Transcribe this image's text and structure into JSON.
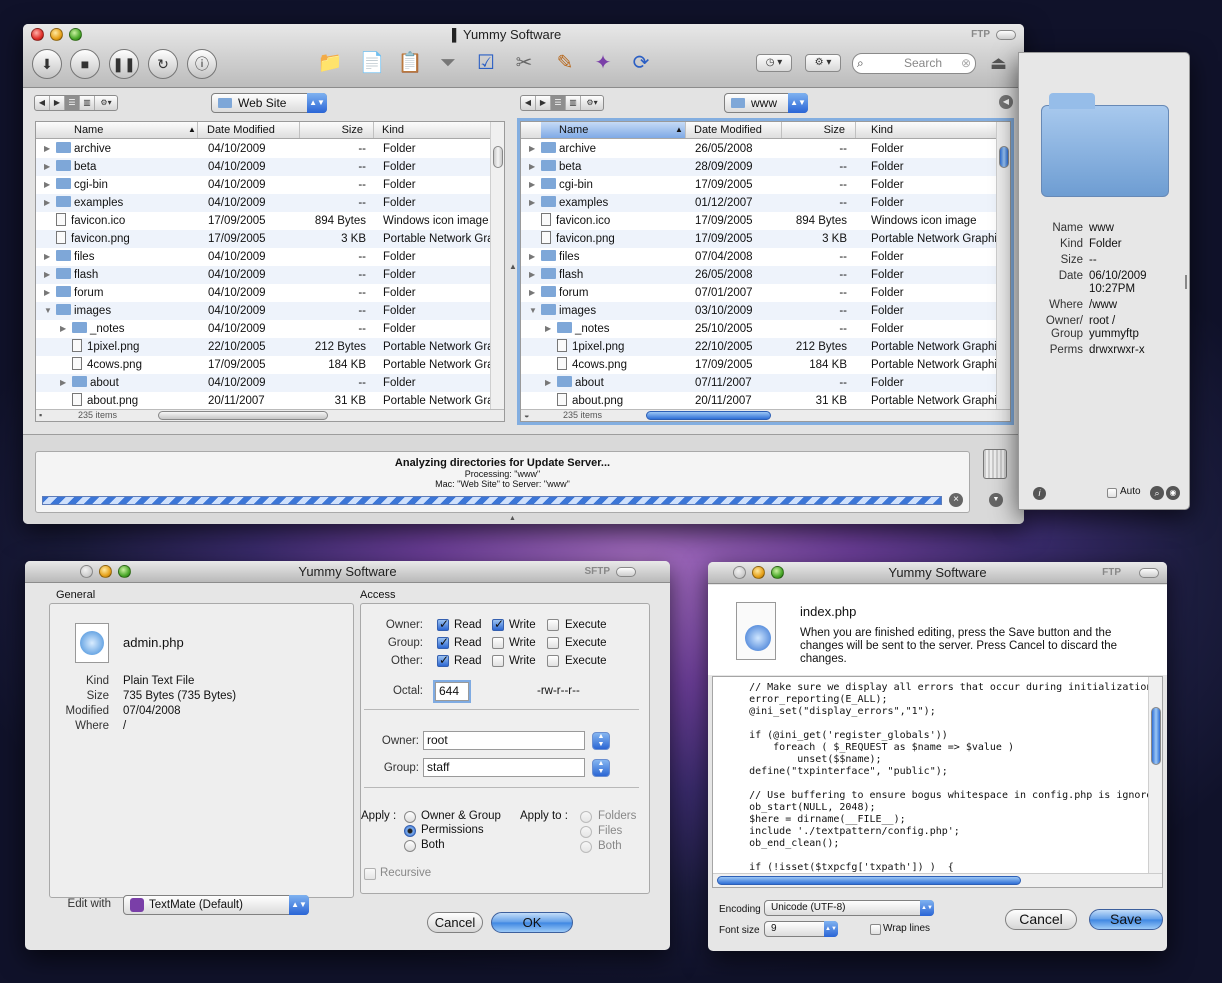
{
  "main_window": {
    "title": "Yummy Software",
    "protocol": "FTP",
    "search_placeholder": "Search",
    "left_path": "Web Site",
    "right_path": "www",
    "columns": {
      "name": "Name",
      "date": "Date Modified",
      "size": "Size",
      "kind": "Kind"
    },
    "left_rows": [
      {
        "name": "archive",
        "date": "04/10/2009",
        "size": "--",
        "kind": "Folder",
        "type": "folder",
        "level": 0,
        "tri": "▶"
      },
      {
        "name": "beta",
        "date": "04/10/2009",
        "size": "--",
        "kind": "Folder",
        "type": "folder",
        "level": 0,
        "tri": "▶"
      },
      {
        "name": "cgi-bin",
        "date": "04/10/2009",
        "size": "--",
        "kind": "Folder",
        "type": "folder",
        "level": 0,
        "tri": "▶"
      },
      {
        "name": "examples",
        "date": "04/10/2009",
        "size": "--",
        "kind": "Folder",
        "type": "folder",
        "level": 0,
        "tri": "▶"
      },
      {
        "name": "favicon.ico",
        "date": "17/09/2005",
        "size": "894 Bytes",
        "kind": "Windows icon image",
        "type": "doc",
        "level": 0,
        "tri": ""
      },
      {
        "name": "favicon.png",
        "date": "17/09/2005",
        "size": "3 KB",
        "kind": "Portable Network Graphics",
        "type": "doc",
        "level": 0,
        "tri": ""
      },
      {
        "name": "files",
        "date": "04/10/2009",
        "size": "--",
        "kind": "Folder",
        "type": "folder",
        "level": 0,
        "tri": "▶"
      },
      {
        "name": "flash",
        "date": "04/10/2009",
        "size": "--",
        "kind": "Folder",
        "type": "folder",
        "level": 0,
        "tri": "▶"
      },
      {
        "name": "forum",
        "date": "04/10/2009",
        "size": "--",
        "kind": "Folder",
        "type": "folder",
        "level": 0,
        "tri": "▶"
      },
      {
        "name": "images",
        "date": "04/10/2009",
        "size": "--",
        "kind": "Folder",
        "type": "folder",
        "level": 0,
        "tri": "▼"
      },
      {
        "name": "_notes",
        "date": "04/10/2009",
        "size": "--",
        "kind": "Folder",
        "type": "folder",
        "level": 1,
        "tri": "▶"
      },
      {
        "name": "1pixel.png",
        "date": "22/10/2005",
        "size": "212 Bytes",
        "kind": "Portable Network Graphics",
        "type": "doc",
        "level": 1,
        "tri": ""
      },
      {
        "name": "4cows.png",
        "date": "17/09/2005",
        "size": "184 KB",
        "kind": "Portable Network Graphics",
        "type": "doc",
        "level": 1,
        "tri": ""
      },
      {
        "name": "about",
        "date": "04/10/2009",
        "size": "--",
        "kind": "Folder",
        "type": "folder",
        "level": 1,
        "tri": "▶"
      },
      {
        "name": "about.png",
        "date": "20/11/2007",
        "size": "31 KB",
        "kind": "Portable Network Graphics",
        "type": "doc",
        "level": 1,
        "tri": ""
      }
    ],
    "right_rows": [
      {
        "name": "archive",
        "date": "26/05/2008",
        "size": "--",
        "kind": "Folder",
        "type": "folder",
        "level": 0,
        "tri": "▶"
      },
      {
        "name": "beta",
        "date": "28/09/2009",
        "size": "--",
        "kind": "Folder",
        "type": "folder",
        "level": 0,
        "tri": "▶"
      },
      {
        "name": "cgi-bin",
        "date": "17/09/2005",
        "size": "--",
        "kind": "Folder",
        "type": "folder",
        "level": 0,
        "tri": "▶"
      },
      {
        "name": "examples",
        "date": "01/12/2007",
        "size": "--",
        "kind": "Folder",
        "type": "folder",
        "level": 0,
        "tri": "▶"
      },
      {
        "name": "favicon.ico",
        "date": "17/09/2005",
        "size": "894 Bytes",
        "kind": "Windows icon image",
        "type": "doc",
        "level": 0,
        "tri": ""
      },
      {
        "name": "favicon.png",
        "date": "17/09/2005",
        "size": "3 KB",
        "kind": "Portable Network Graphics",
        "type": "doc",
        "level": 0,
        "tri": ""
      },
      {
        "name": "files",
        "date": "07/04/2008",
        "size": "--",
        "kind": "Folder",
        "type": "folder",
        "level": 0,
        "tri": "▶"
      },
      {
        "name": "flash",
        "date": "26/05/2008",
        "size": "--",
        "kind": "Folder",
        "type": "folder",
        "level": 0,
        "tri": "▶"
      },
      {
        "name": "forum",
        "date": "07/01/2007",
        "size": "--",
        "kind": "Folder",
        "type": "folder",
        "level": 0,
        "tri": "▶"
      },
      {
        "name": "images",
        "date": "03/10/2009",
        "size": "--",
        "kind": "Folder",
        "type": "folder",
        "level": 0,
        "tri": "▼"
      },
      {
        "name": "_notes",
        "date": "25/10/2005",
        "size": "--",
        "kind": "Folder",
        "type": "folder",
        "level": 1,
        "tri": "▶"
      },
      {
        "name": "1pixel.png",
        "date": "22/10/2005",
        "size": "212 Bytes",
        "kind": "Portable Network Graphics",
        "type": "doc",
        "level": 1,
        "tri": ""
      },
      {
        "name": "4cows.png",
        "date": "17/09/2005",
        "size": "184 KB",
        "kind": "Portable Network Graphics",
        "type": "doc",
        "level": 1,
        "tri": ""
      },
      {
        "name": "about",
        "date": "07/11/2007",
        "size": "--",
        "kind": "Folder",
        "type": "folder",
        "level": 1,
        "tri": "▶"
      },
      {
        "name": "about.png",
        "date": "20/11/2007",
        "size": "31 KB",
        "kind": "Portable Network Graphics",
        "type": "doc",
        "level": 1,
        "tri": ""
      }
    ],
    "left_count": "235 items",
    "right_count": "235 items",
    "status_title": "Analyzing directories for Update Server...",
    "status_processing": "Processing: \"www\"",
    "status_detail": "Mac: \"Web Site\" to Server: \"www\"",
    "progress": 1.0
  },
  "info_panel": {
    "name_label": "Name",
    "name": "www",
    "kind_label": "Kind",
    "kind": "Folder",
    "size_label": "Size",
    "size": "--",
    "date_label": "Date",
    "date": "06/10/2009",
    "time": "10:27PM",
    "where_label": "Where",
    "where": "/www",
    "owner_label": "Owner/",
    "group_label": "Group",
    "owner": "root /",
    "group": "yummyftp",
    "perms_label": "Perms",
    "perms": "drwxrwxr-x",
    "auto_label": "Auto"
  },
  "perm_window": {
    "title": "Yummy Software",
    "protocol": "SFTP",
    "general": "General",
    "access": "Access",
    "filename": "admin.php",
    "kind_label": "Kind",
    "kind": "Plain Text File",
    "size_label": "Size",
    "size": "735 Bytes (735 Bytes)",
    "modified_label": "Modified",
    "modified": "07/04/2008",
    "where_label": "Where",
    "where": "/",
    "owner_lbl": "Owner:",
    "group_lbl": "Group:",
    "other_lbl": "Other:",
    "read": "Read",
    "write": "Write",
    "execute": "Execute",
    "octal_lbl": "Octal:",
    "octal": "644",
    "symbolic": "-rw-r--r--",
    "owner_field_lbl": "Owner:",
    "owner_field": "root",
    "group_field_lbl": "Group:",
    "group_field": "staff",
    "apply_lbl": "Apply :",
    "apply_owner_group": "Owner & Group",
    "apply_permissions": "Permissions",
    "apply_both": "Both",
    "applyto_lbl": "Apply to :",
    "applyto_folders": "Folders",
    "applyto_files": "Files",
    "applyto_both": "Both",
    "recursive": "Recursive",
    "edit_with_lbl": "Edit with",
    "edit_with": "TextMate (Default)",
    "cancel": "Cancel",
    "ok": "OK"
  },
  "editor_window": {
    "title": "Yummy Software",
    "protocol": "FTP",
    "filename": "index.php",
    "message": "When you are finished editing, press the Save button and the changes will be sent to the server. Press Cancel to discard the changes.",
    "code": [
      "    // Make sure we display all errors that occur during initialization",
      "    error_reporting(E_ALL);",
      "    @ini_set(\"display_errors\",\"1\");",
      "",
      "    if (@ini_get('register_globals'))",
      "        foreach ( $_REQUEST as $name => $value )",
      "            unset($$name);",
      "    define(\"txpinterface\", \"public\");",
      "",
      "    // Use buffering to ensure bogus whitespace in config.php is ignored",
      "    ob_start(NULL, 2048);",
      "    $here = dirname(__FILE__);",
      "    include './textpattern/config.php';",
      "    ob_end_clean();",
      "",
      "    if (!isset($txpcfg['txpath']) )  {"
    ],
    "encoding_lbl": "Encoding",
    "encoding": "Unicode (UTF-8)",
    "fontsize_lbl": "Font size",
    "fontsize": "9",
    "wrap_lbl": "Wrap lines",
    "cancel": "Cancel",
    "save": "Save"
  }
}
